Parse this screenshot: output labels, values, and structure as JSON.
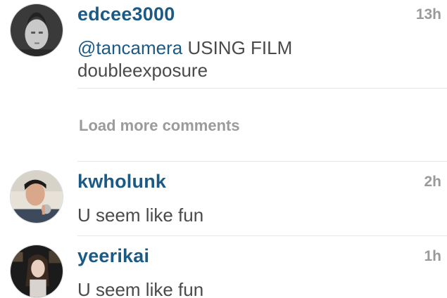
{
  "comments": [
    {
      "username": "edcee3000",
      "time": "13h",
      "mention": "@tancamera",
      "text_line1_rest": " USING FILM",
      "text_line2": "doubleexposure"
    },
    {
      "username": "kwholunk",
      "time": "2h",
      "text": "U seem like fun"
    },
    {
      "username": "yeerikai",
      "time": "1h",
      "text": "U seem like fun"
    }
  ],
  "load_more_label": "Load more comments",
  "colors": {
    "username": "#1c5a86",
    "time": "#9a9a9a",
    "text": "#4a4a4a",
    "load_more": "#9b9b9b"
  }
}
